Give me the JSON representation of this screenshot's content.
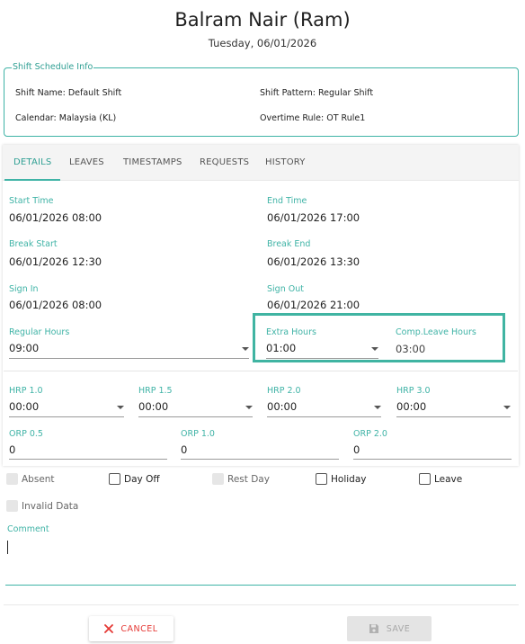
{
  "header": {
    "name": "Balram Nair (Ram)",
    "date": "Tuesday, 06/01/2026"
  },
  "shift_info": {
    "legend": "Shift Schedule Info",
    "shift_name": "Shift Name:  Default Shift",
    "shift_pattern": "Shift Pattern:  Regular Shift",
    "calendar": "Calendar:  Malaysia (KL)",
    "overtime_rule": "Overtime Rule:  OT Rule1"
  },
  "tabs": [
    {
      "label": "DETAILS",
      "active": true
    },
    {
      "label": "LEAVES"
    },
    {
      "label": "TIMESTAMPS"
    },
    {
      "label": "REQUESTS"
    },
    {
      "label": "HISTORY"
    }
  ],
  "details": {
    "start_time": {
      "label": "Start Time",
      "value": "06/01/2026 08:00"
    },
    "end_time": {
      "label": "End Time",
      "value": "06/01/2026 17:00"
    },
    "break_start": {
      "label": "Break Start",
      "value": "06/01/2026 12:30"
    },
    "break_end": {
      "label": "Break End",
      "value": "06/01/2026 13:30"
    },
    "sign_in": {
      "label": "Sign In",
      "value": "06/01/2026 08:00"
    },
    "sign_out": {
      "label": "Sign Out",
      "value": "06/01/2026 21:00"
    },
    "regular_hours": {
      "label": "Regular Hours",
      "value": "09:00"
    },
    "extra_hours": {
      "label": "Extra Hours",
      "value": "01:00"
    },
    "comp_leave_hours": {
      "label": "Comp.Leave Hours",
      "value": "03:00"
    },
    "hrp_1_0": {
      "label": "HRP 1.0",
      "value": "00:00"
    },
    "hrp_1_5": {
      "label": "HRP 1.5",
      "value": "00:00"
    },
    "hrp_2_0": {
      "label": "HRP 2.0",
      "value": "00:00"
    },
    "hrp_3_0": {
      "label": "HRP 3.0",
      "value": "00:00"
    },
    "orp_0_5": {
      "label": "ORP 0.5",
      "value": "0"
    },
    "orp_1_0": {
      "label": "ORP 1.0",
      "value": "0"
    },
    "orp_2_0": {
      "label": "ORP 2.0",
      "value": "0"
    }
  },
  "flags": {
    "absent": "Absent",
    "day_off": "Day Off",
    "rest_day": "Rest Day",
    "holiday": "Holiday",
    "leave": "Leave",
    "invalid_data": "Invalid Data"
  },
  "comment": {
    "label": "Comment",
    "value": ""
  },
  "buttons": {
    "cancel": "CANCEL",
    "save": "SAVE"
  },
  "colors": {
    "accent": "#3fb3a6",
    "highlight_border": "#40b4a2",
    "cancel": "#e53935",
    "disabled": "#a8a8a8"
  }
}
